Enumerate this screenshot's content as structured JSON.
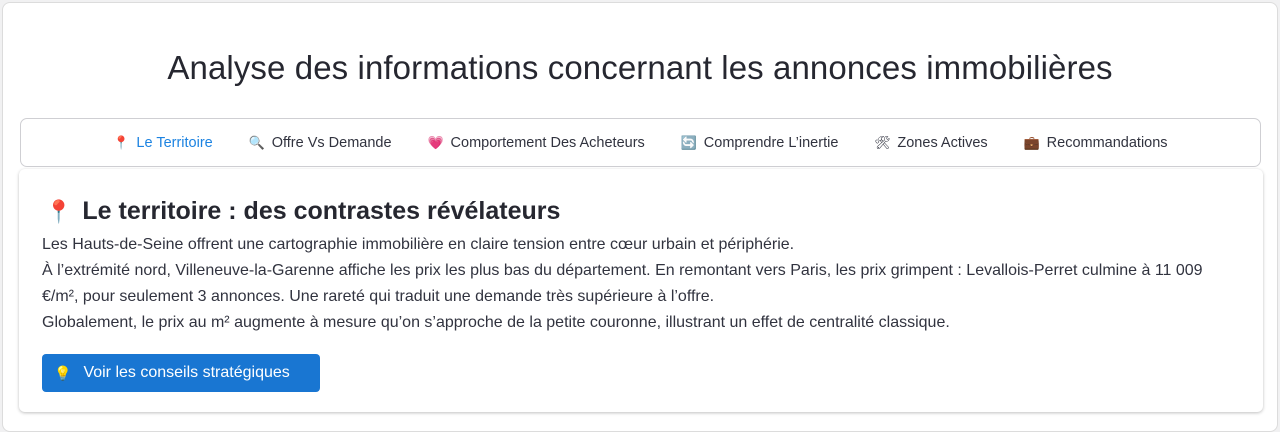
{
  "page": {
    "title": "Analyse des informations concernant les annonces immobilières"
  },
  "tabs": [
    {
      "icon": "📍",
      "icon_name": "pin-icon",
      "label": "Le Territoire",
      "active": true
    },
    {
      "icon": "🔍",
      "icon_name": "magnifier-icon",
      "label": "Offre Vs Demande",
      "active": false
    },
    {
      "icon": "💗",
      "icon_name": "heart-icon",
      "label": "Comportement Des Acheteurs",
      "active": false
    },
    {
      "icon": "🔄",
      "icon_name": "refresh-icon",
      "label": "Comprendre L’inertie",
      "active": false
    },
    {
      "icon": "🛠",
      "icon_name": "tools-icon",
      "label": "Zones Actives",
      "active": false
    },
    {
      "icon": "💼",
      "icon_name": "briefcase-icon",
      "label": "Recommandations",
      "active": false
    }
  ],
  "section": {
    "icon": "📍",
    "title": "Le territoire : des contrastes révélateurs",
    "paragraphs": [
      "Les Hauts-de-Seine offrent une cartographie immobilière en claire tension entre cœur urbain et périphérie.",
      "À l’extrémité nord, Villeneuve-la-Garenne affiche les prix les plus bas du département. En remontant vers Paris, les prix grimpent : Levallois-Perret culmine à 11 009 €/m², pour seulement 3 annonces. Une rareté qui traduit une demande très supérieure à l’offre.",
      "Globalement, le prix au m² augmente à mesure qu’on s’approche de la petite couronne, illustrant un effet de centralité classique."
    ],
    "button_icon": "💡",
    "button_label": "Voir les conseils stratégiques"
  },
  "colors": {
    "accent": "#1c83e1",
    "button": "#1976d2",
    "text": "#31333f"
  }
}
